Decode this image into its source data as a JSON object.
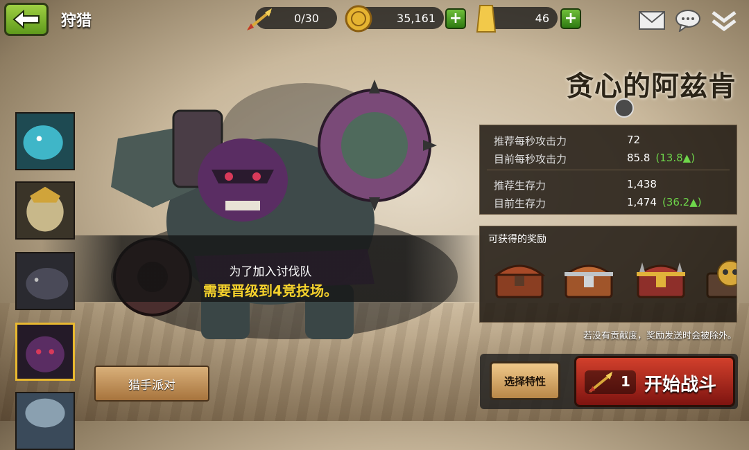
{
  "header": {
    "title": "狩猎",
    "back_icon": "back-arrow-icon"
  },
  "resources": {
    "stamina": "0/30",
    "gold": "35,161",
    "gems": "46",
    "plus_label": "+"
  },
  "boss": {
    "name": "贪心的阿兹肯"
  },
  "stats": {
    "rec_dps_label": "推荐每秒攻击力",
    "rec_dps_value": "72",
    "cur_dps_label": "目前每秒攻击力",
    "cur_dps_value": "85.8",
    "cur_dps_delta": "(13.8▲)",
    "rec_surv_label": "推荐生存力",
    "rec_surv_value": "1,438",
    "cur_surv_label": "目前生存力",
    "cur_surv_value": "1,474",
    "cur_surv_delta": "(36.2▲)"
  },
  "rewards": {
    "title": "可获得的奖励",
    "note": "若没有贡献度，奖励发送时会被除外。"
  },
  "banner": {
    "line1": "为了加入讨伐队",
    "line2": "需要晋级到4竞技场。"
  },
  "buttons": {
    "hunter_party": "猎手派对",
    "select_trait": "选择特性",
    "start_cost": "1",
    "start_battle": "开始战斗"
  },
  "colors": {
    "accent_green": "#6ed64a",
    "banner_yellow": "#f5d22c",
    "start_red": "#c2331f"
  }
}
